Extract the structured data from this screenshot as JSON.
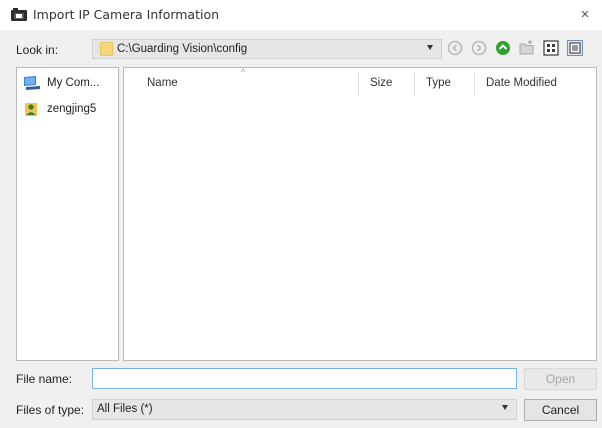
{
  "window": {
    "title": "Import IP Camera Information",
    "close_glyph": "×"
  },
  "look_in": {
    "label": "Look in:",
    "value": "C:\\Guarding Vision\\config",
    "icon": "folder-icon"
  },
  "toolbar": {
    "buttons": [
      {
        "name": "back-icon",
        "glyph": "‹",
        "state": "disabled"
      },
      {
        "name": "forward-icon",
        "glyph": "›",
        "state": "disabled"
      },
      {
        "name": "up-folder-icon",
        "glyph": "↑",
        "state": "enabled"
      },
      {
        "name": "new-folder-icon",
        "state": "disabled"
      },
      {
        "name": "list-view-icon",
        "state": "enabled"
      },
      {
        "name": "details-view-icon",
        "state": "active"
      }
    ]
  },
  "places": {
    "items": [
      {
        "label": "My Com...",
        "icon": "computer-icon"
      },
      {
        "label": "zengjing5",
        "icon": "user-folder-icon"
      }
    ]
  },
  "file_list": {
    "columns": [
      "Name",
      "Size",
      "Type",
      "Date Modified"
    ],
    "sort_indicator": "^",
    "rows": []
  },
  "file_name": {
    "label": "File name:",
    "value": "",
    "placeholder": ""
  },
  "file_type": {
    "label": "Files of type:",
    "value": "All Files (*)"
  },
  "buttons": {
    "open": "Open",
    "cancel": "Cancel"
  },
  "colors": {
    "dialog_bg": "#f0f0f0",
    "input_focus_border": "#7eb4ea",
    "folder_yellow": "#f6d77a",
    "up_button_green": "#2fa12f"
  }
}
